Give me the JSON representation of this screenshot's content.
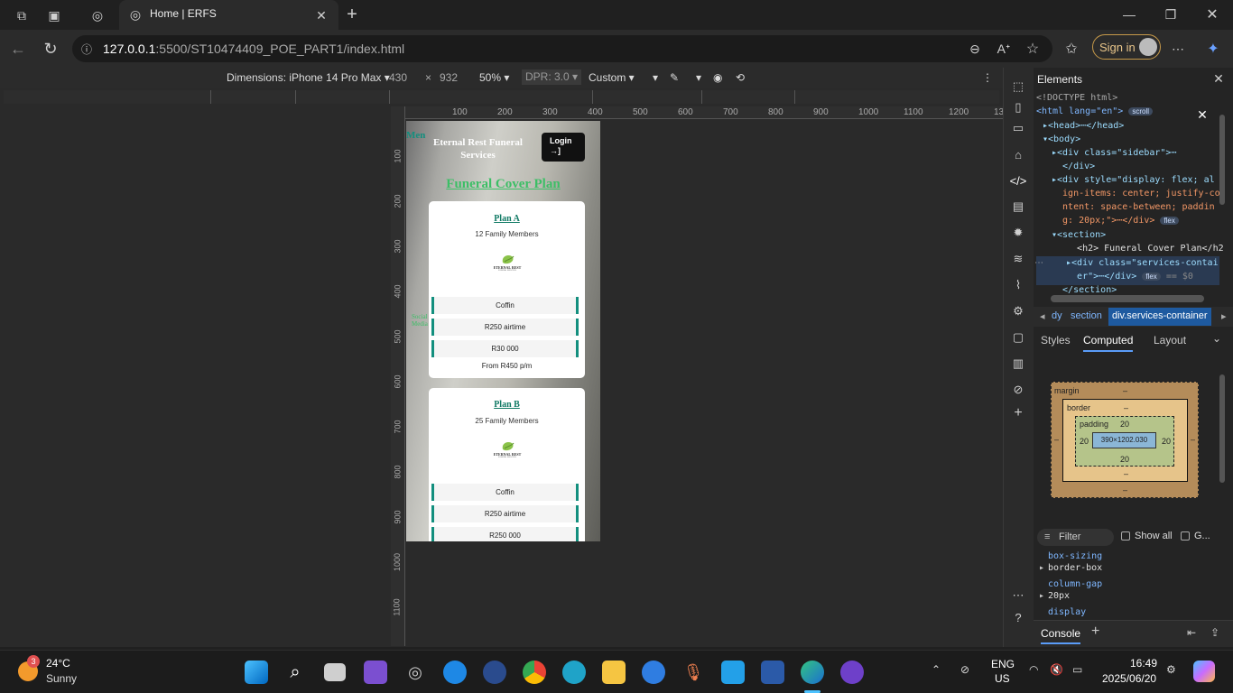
{
  "browser": {
    "tab_title": "Home | ERFS",
    "url_host": "127.0.0.1",
    "url_path": ":5500/ST10474409_POE_PART1/index.html",
    "sign_in_label": "Sign in"
  },
  "device_toolbar": {
    "dimensions_label": "Dimensions: iPhone 14 Pro Max",
    "width": "430",
    "times": "×",
    "height": "932",
    "zoom": "50%",
    "dpr": "DPR: 3.0",
    "throttle": "Custom"
  },
  "ruler_top": [
    "100",
    "200",
    "300",
    "400",
    "500",
    "600",
    "700",
    "800",
    "900",
    "1000",
    "1100",
    "1200",
    "13"
  ],
  "ruler_left": [
    "100",
    "200",
    "300",
    "400",
    "500",
    "600",
    "700",
    "800",
    "900",
    "1000",
    "1100"
  ],
  "page": {
    "menu_label": "Men",
    "site_title": "Eternal Rest Funeral Services",
    "login_label": "Login",
    "login_icon": "→]",
    "sidebar_fragment": "Social Media",
    "section_heading": "Funeral Cover Plan",
    "logo_text": "ETERNAL REST",
    "logo_subtext": "FUNERAL SERVICES",
    "plans": [
      {
        "name": "Plan A",
        "members": "12 Family Members",
        "rows": [
          "Coffin",
          "R250 airtime",
          "R30 000"
        ],
        "price": "From R450 p/m"
      },
      {
        "name": "Plan B",
        "members": "25 Family Members",
        "rows": [
          "Coffin",
          "R250 airtime",
          "R250 000"
        ]
      }
    ]
  },
  "devtools": {
    "panel_title": "Elements",
    "lines": [
      {
        "text": "<!DOCTYPE html>"
      },
      {
        "text": "<html lang=\"en\">",
        "badge": "scroll"
      },
      {
        "text": "▸<head>⋯</head>"
      },
      {
        "text": "▾<body>"
      },
      {
        "text": "▸<div class=\"sidebar\">⋯"
      },
      {
        "text": "  </div>"
      },
      {
        "text": "▸<div style=\"display: flex; al"
      },
      {
        "text": "  ign-items: center; justify-co"
      },
      {
        "text": "  ntent: space-between; paddin"
      },
      {
        "text": "  g: 20px;\">⋯</div>",
        "badge": "flex"
      },
      {
        "text": "▾<section>"
      },
      {
        "text": "   <h2> Funeral Cover Plan</h2"
      },
      {
        "text": " ▸<div class=\"services-contai"
      },
      {
        "text": "   er\">⋯</div>",
        "badge": "flex",
        "extra": "== $0"
      },
      {
        "text": "  </section>"
      }
    ],
    "breadcrumbs": [
      "dy",
      "section",
      "div.services-container"
    ],
    "tabs": [
      "Styles",
      "Computed",
      "Layout"
    ],
    "active_tab": "Computed",
    "box_model": {
      "margin_label": "margin",
      "margin_value": "–",
      "border_label": "border",
      "border_value": "–",
      "padding_label": "padding",
      "padding_top": "20",
      "padding_left": "20",
      "padding_right": "20",
      "padding_bottom": "20",
      "content": "390×1202.030"
    },
    "filter_placeholder": "Filter",
    "show_all_label": "Show all",
    "group_label": "G...",
    "props": [
      {
        "name": "box-sizing",
        "value": "border-box"
      },
      {
        "name": "column-gap",
        "value": "20px"
      },
      {
        "name": "display",
        "value": ""
      }
    ],
    "console_label": "Console"
  },
  "taskbar": {
    "weather_temp": "24°C",
    "weather_desc": "Sunny",
    "weather_badge": "3",
    "lang_top": "ENG",
    "lang_bottom": "US",
    "time": "16:49",
    "date": "2025/06/20"
  },
  "colors": {
    "accent_teal": "#138f7e",
    "heading_green": "#3cbf66",
    "plan_title": "#117a65",
    "devtools_bg": "#242424"
  }
}
